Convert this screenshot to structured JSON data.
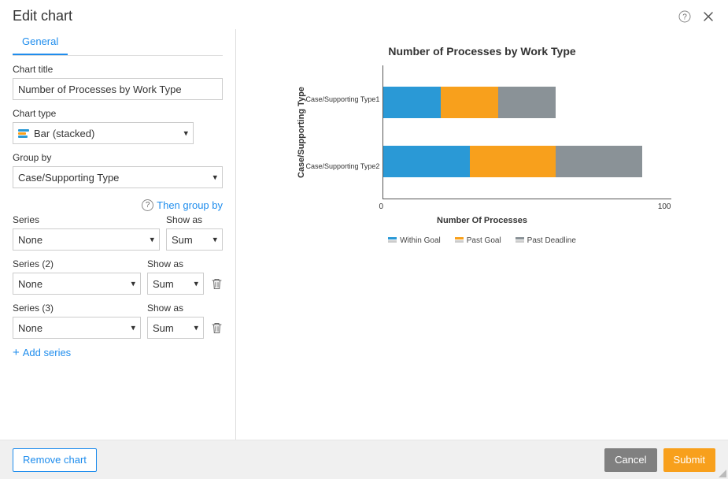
{
  "header": {
    "title": "Edit chart"
  },
  "tabs": {
    "general": "General"
  },
  "form": {
    "chartTitleLabel": "Chart title",
    "chartTitleValue": "Number of Processes by Work Type",
    "chartTypeLabel": "Chart type",
    "chartTypeValue": "Bar (stacked)",
    "groupByLabel": "Group by",
    "groupByValue": "Case/Supporting Type",
    "thenGroupBy": "Then group by",
    "seriesLabel": "Series",
    "series2Label": "Series (2)",
    "series3Label": "Series (3)",
    "showAsLabel": "Show as",
    "noneValue": "None",
    "sumValue": "Sum",
    "addSeries": "Add series"
  },
  "footer": {
    "removeChart": "Remove chart",
    "cancel": "Cancel",
    "submit": "Submit"
  },
  "chart": {
    "title": "Number of Processes by Work Type",
    "yAxisTitle": "Case/Supporting Type",
    "xAxisTitle": "Number Of Processes",
    "xTicks": [
      "0",
      "100"
    ],
    "categories": [
      "Case/Supporting Type1",
      "Case/Supporting Type2"
    ],
    "legend": [
      "Within Goal",
      "Past Goal",
      "Past Deadline"
    ]
  },
  "chart_data": {
    "type": "bar",
    "orientation": "horizontal",
    "stacked": true,
    "title": "Number of Processes by Work Type",
    "xlabel": "Number Of Processes",
    "ylabel": "Case/Supporting Type",
    "xlim": [
      0,
      100
    ],
    "categories": [
      "Case/Supporting Type1",
      "Case/Supporting Type2"
    ],
    "series": [
      {
        "name": "Within Goal",
        "color": "#2A99D6",
        "values": [
          20,
          30
        ]
      },
      {
        "name": "Past Goal",
        "color": "#F8A01C",
        "values": [
          20,
          30
        ]
      },
      {
        "name": "Past Deadline",
        "color": "#8A9297",
        "values": [
          20,
          30
        ]
      }
    ]
  }
}
